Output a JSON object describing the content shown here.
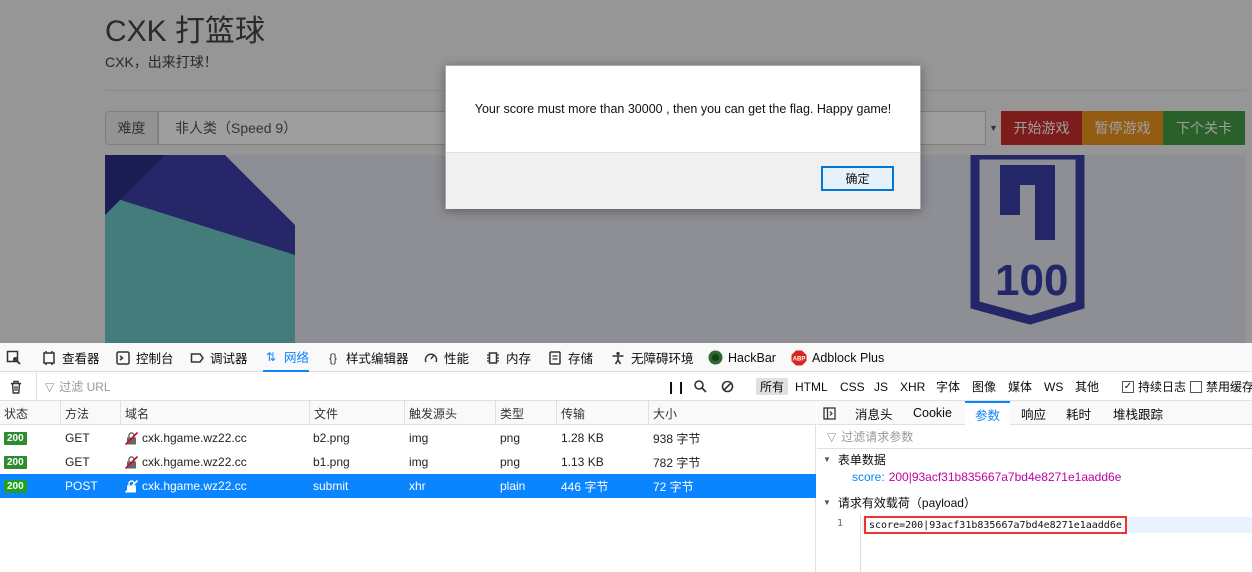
{
  "page": {
    "title": "CXK 打篮球",
    "subtitle": "CXK，出来打球！",
    "difficulty_label": "难度",
    "difficulty_value": "非人类（Speed 9）",
    "buttons": {
      "start": "开始游戏",
      "pause": "暂停游戏",
      "next": "下个关卡"
    }
  },
  "dialog": {
    "message": "Your score must more than 30000 , then you can get the flag. Happy game!",
    "ok_label": "确定"
  },
  "devtools": {
    "tabs": [
      {
        "label": "查看器"
      },
      {
        "label": "控制台"
      },
      {
        "label": "调试器"
      },
      {
        "label": "网络"
      },
      {
        "label": "样式编辑器"
      },
      {
        "label": "性能"
      },
      {
        "label": "内存"
      },
      {
        "label": "存储"
      },
      {
        "label": "无障碍环境"
      },
      {
        "label": "HackBar"
      },
      {
        "label": "Adblock Plus"
      }
    ],
    "filter": {
      "placeholder": "过滤 URL",
      "types": [
        "所有",
        "HTML",
        "CSS",
        "JS",
        "XHR",
        "字体",
        "图像",
        "媒体",
        "WS",
        "其他"
      ],
      "persist_logs": "持续日志",
      "disable_cache": "禁用缓存"
    },
    "columns": [
      "状态",
      "方法",
      "域名",
      "文件",
      "触发源头",
      "类型",
      "传输",
      "大小"
    ],
    "requests": [
      {
        "status": "200",
        "method": "GET",
        "domain": "cxk.hgame.wz22.cc",
        "file": "b2.png",
        "cause": "img",
        "type": "png",
        "transferred": "1.28 KB",
        "size": "938 字节"
      },
      {
        "status": "200",
        "method": "GET",
        "domain": "cxk.hgame.wz22.cc",
        "file": "b1.png",
        "cause": "img",
        "type": "png",
        "transferred": "1.13 KB",
        "size": "782 字节"
      },
      {
        "status": "200",
        "method": "POST",
        "domain": "cxk.hgame.wz22.cc",
        "file": "submit",
        "cause": "xhr",
        "type": "plain",
        "transferred": "446 字节",
        "size": "72 字节"
      }
    ],
    "detail": {
      "tabs": [
        "消息头",
        "Cookie",
        "参数",
        "响应",
        "耗时",
        "堆栈跟踪"
      ],
      "filter_placeholder": "过滤请求参数",
      "form_section": "表单数据",
      "form_key": "score:",
      "form_value": "200|93acf31b835667a7bd4e8271e1aadd6e",
      "payload_section": "请求有效载荷（payload）",
      "payload_line_number": "1",
      "payload_text": "score=200|93acf31b835667a7bd4e8271e1aadd6e"
    }
  },
  "colors": {
    "accent_blue": "#0a84ff",
    "status_green": "#2f8b2f",
    "btn_start": "#c9302c",
    "btn_pause": "#ec971f",
    "btn_next": "#449d44",
    "form_value": "#c100a3",
    "highlight_box": "#e33333"
  }
}
